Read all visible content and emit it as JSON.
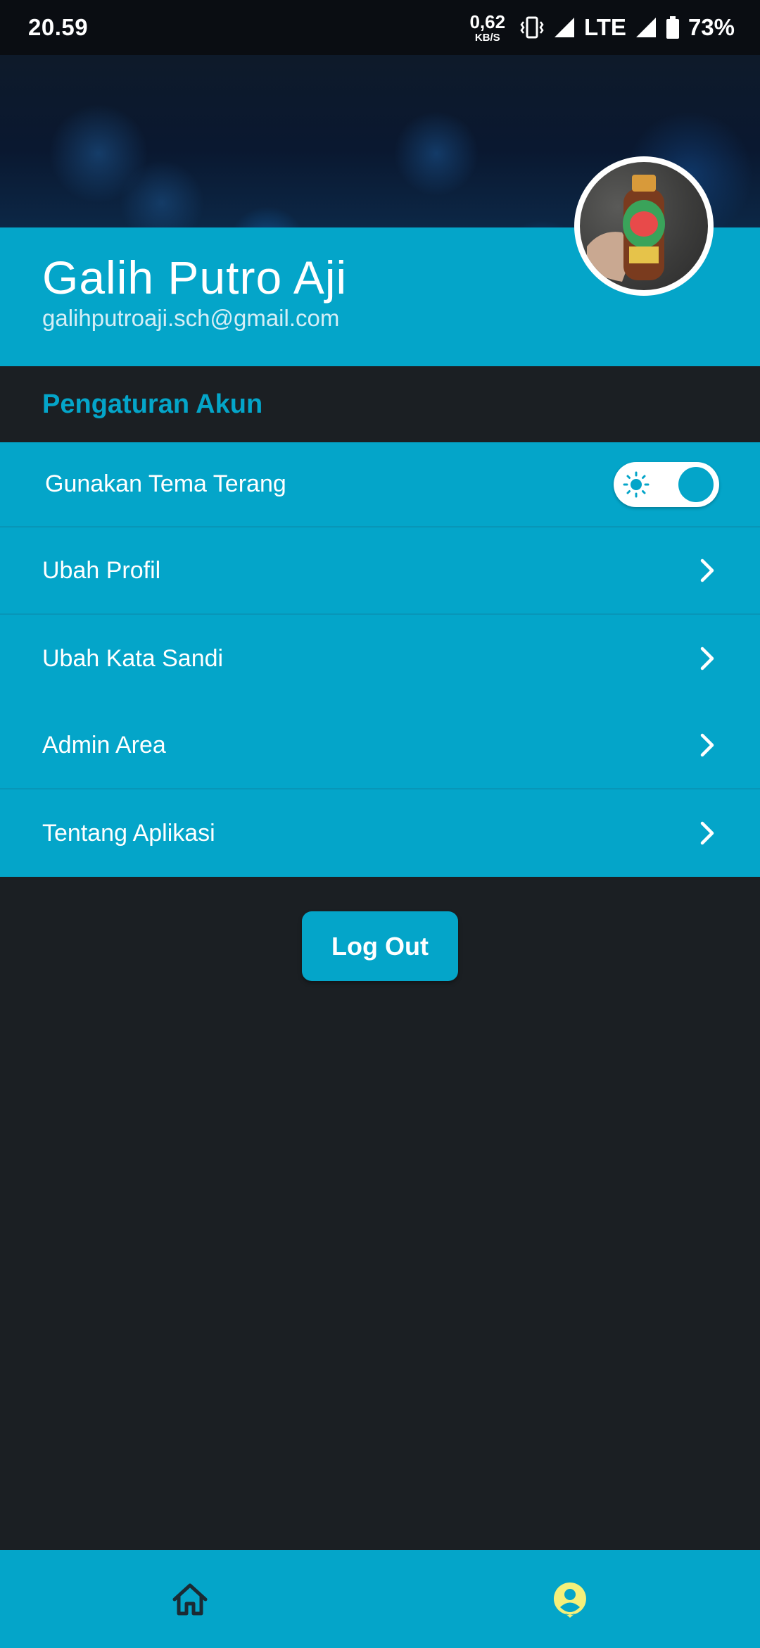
{
  "status_bar": {
    "time": "20.59",
    "net_speed_value": "0,62",
    "net_speed_unit": "KB/S",
    "network": "LTE",
    "battery": "73%"
  },
  "profile": {
    "name": "Galih Putro Aji",
    "email": "galihputroaji.sch@gmail.com"
  },
  "section": {
    "title": "Pengaturan Akun"
  },
  "settings": {
    "theme_label": "Gunakan Tema Terang",
    "theme_toggle_on": true,
    "items": [
      {
        "label": "Ubah Profil"
      },
      {
        "label": "Ubah Kata Sandi"
      },
      {
        "label": "Admin Area"
      },
      {
        "label": "Tentang Aplikasi"
      }
    ]
  },
  "logout_label": "Log Out",
  "bottom_nav": {
    "items": [
      {
        "icon": "home-icon",
        "active": false
      },
      {
        "icon": "profile-icon",
        "active": true
      }
    ]
  },
  "colors": {
    "accent": "#04a5c9",
    "background": "#1b1f23",
    "active_nav_icon": "#f5f07a",
    "inactive_nav_icon": "#1b2a33"
  }
}
